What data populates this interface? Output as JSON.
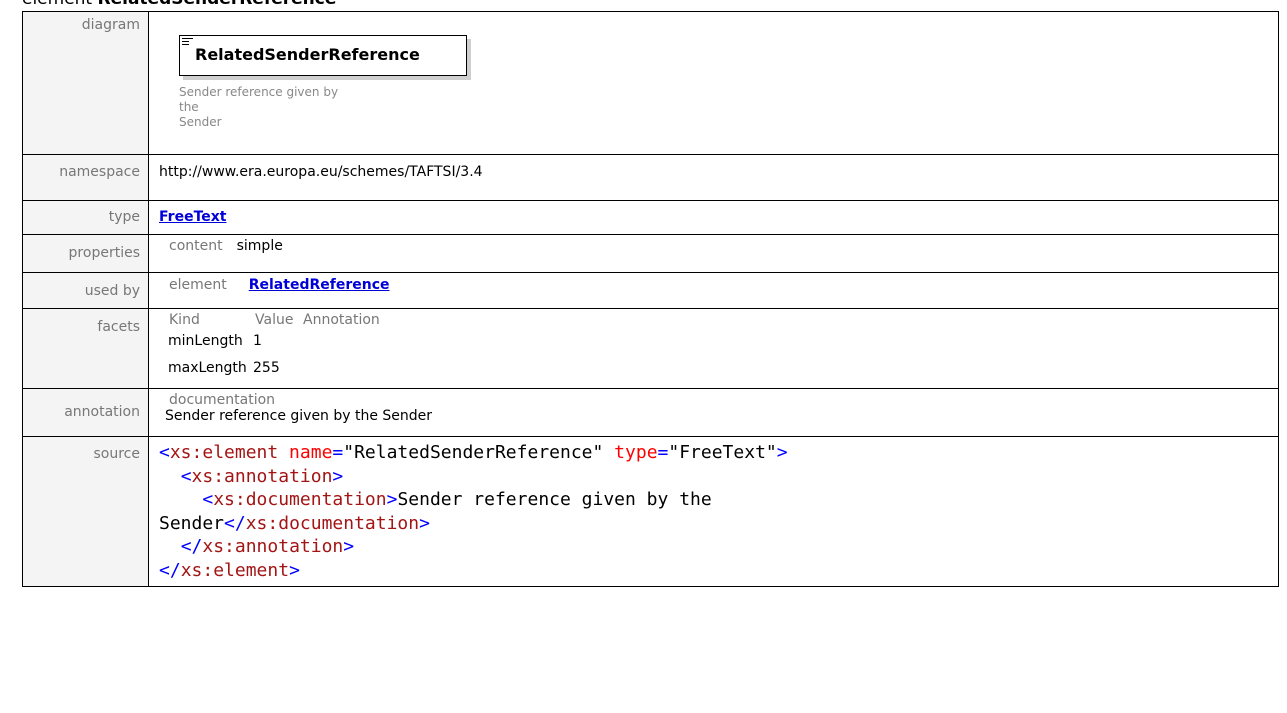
{
  "title": {
    "prefix": "element",
    "name": "RelatedSenderReference"
  },
  "diagram": {
    "element_name": "RelatedSenderReference",
    "description_line1": "Sender reference given by the",
    "description_line2": "Sender"
  },
  "rows": {
    "diagram_label": "diagram",
    "namespace_label": "namespace",
    "namespace_value": "http://www.era.europa.eu/schemes/TAFTSI/3.4",
    "type_label": "type",
    "type_value": "FreeText",
    "properties_label": "properties",
    "properties_key": "content",
    "properties_value": "simple",
    "usedby_label": "used by",
    "usedby_key": "element",
    "usedby_value": "RelatedReference",
    "facets_label": "facets",
    "annotation_label": "annotation",
    "annotation_key": "documentation",
    "annotation_value": "Sender reference given by the Sender",
    "source_label": "source"
  },
  "facets": {
    "headers": [
      "Kind",
      "Value",
      "Annotation"
    ],
    "rows": [
      {
        "kind": "minLength",
        "value": "1"
      },
      {
        "kind": "maxLength",
        "value": "255"
      }
    ]
  },
  "source": {
    "l1_open": "<",
    "l1_tag": "xs:element",
    "l1_attr1": " name",
    "l1_eq1": "=",
    "l1_val1": "\"RelatedSenderReference\"",
    "l1_attr2": " type",
    "l1_eq2": "=",
    "l1_val2": "\"FreeText\"",
    "l1_close": ">",
    "l2_open": "<",
    "l2_tag": "xs:annotation",
    "l2_close": ">",
    "l3_open": "<",
    "l3_tag": "xs:documentation",
    "l3_close": ">",
    "l3_text": "Sender reference given by the",
    "l4_text": "Sender",
    "l4_open": "</",
    "l4_tag": "xs:documentation",
    "l4_close": ">",
    "l5_open": "</",
    "l5_tag": "xs:annotation",
    "l5_close": ">",
    "l6_open": "</",
    "l6_tag": "xs:element",
    "l6_close": ">"
  }
}
